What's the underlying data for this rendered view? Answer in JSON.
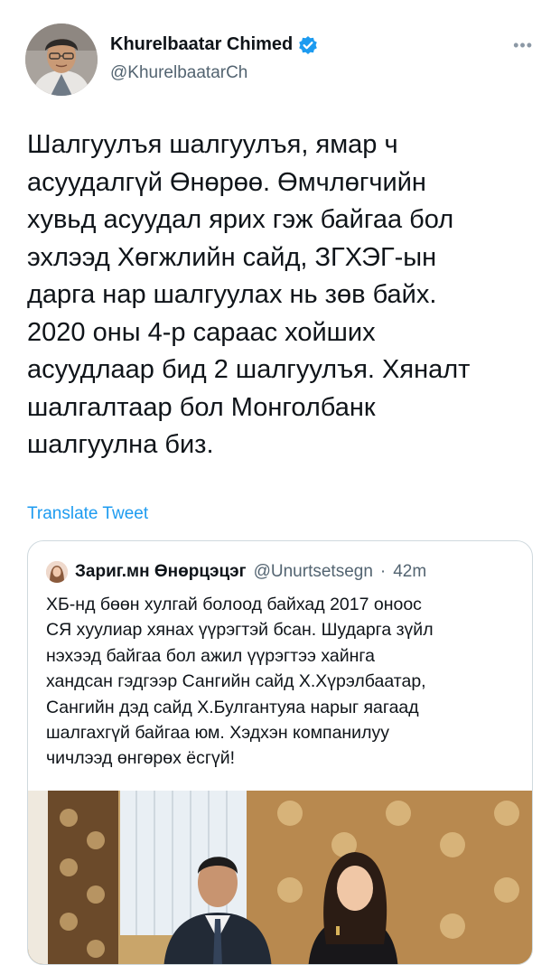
{
  "author": {
    "display_name": "Khurelbaatar Chimed",
    "handle": "@KhurelbaatarCh",
    "verified_icon": "verified-badge-icon",
    "more_icon": "more-options-icon"
  },
  "tweet": {
    "text": "Шалгуулъя шалгуулъя, ямар ч\nасуудалгүй Өнөрөө. Өмчлөгчийн\nхувьд асуудал ярих гэж байгаа бол\nэхлээд Хөгжлийн сайд, ЗГХЭГ-ын\nдарга нар шалгуулах нь зөв байх.\n2020 оны 4-р сараас хойших\nасуудлаар бид 2 шалгуулъя. Хяналт\nшалгалтаар бол Монголбанк\nшалгуулна биз.",
    "translate_label": "Translate Tweet"
  },
  "quote": {
    "display_name": "Зариг.мн Өнөрцэцэг",
    "handle": "@Unurtsetsegn",
    "separator": "·",
    "time": "42m",
    "text": "ХБ-нд  бөөн хулгай болоод байхад 2017 оноос\nСЯ  хуулиар хянах үүрэгтэй бсан. Шударга зүйл\nнэхээд байгаа бол ажил үүрэгтээ хайнга\nхандсан гэдгээр Сангийн сайд Х.Хүрэлбаатар,\nСангийн дэд сайд Х.Булгантуяа нарыг яагаад\nшалгахгүй байгаа юм. Хэдхэн компанилуу\nчичлээд өнгөрөх ёсгүй!"
  },
  "colors": {
    "accent": "#1d9bf0",
    "text": "#0f1419",
    "muted": "#536471",
    "border": "#cfd9de"
  }
}
